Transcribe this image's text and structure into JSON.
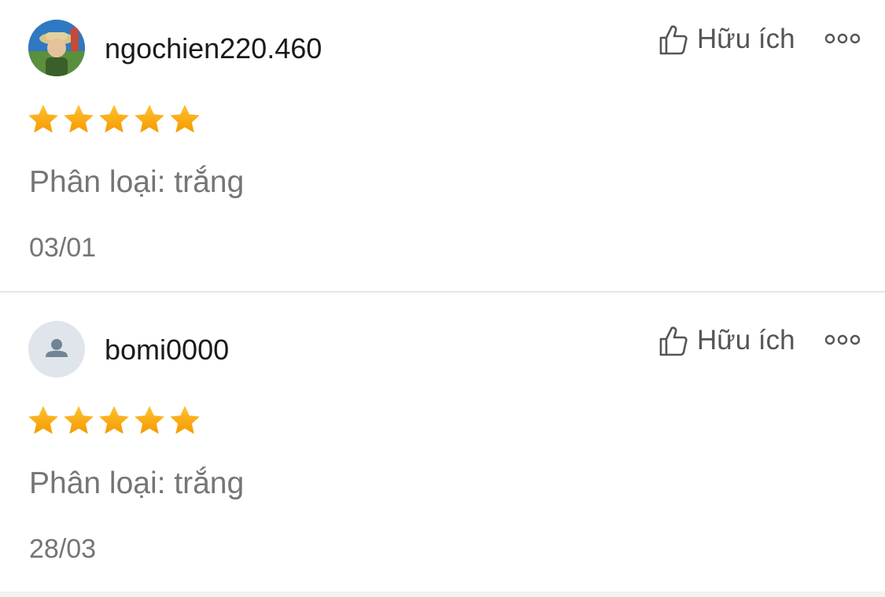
{
  "reviews": [
    {
      "username": "ngochien220.460",
      "avatar": "user-photo",
      "rating": 5,
      "helpful_label": "Hữu ích",
      "variation": "Phân loại: trắng",
      "date": "03/01"
    },
    {
      "username": "bomi0000",
      "avatar": "default-user-icon",
      "rating": 5,
      "helpful_label": "Hữu ích",
      "variation": "Phân loại: trắng",
      "date": "28/03"
    }
  ],
  "icons": {
    "helpful": "thumbs-up-icon",
    "more": "more-options-icon",
    "star": "star-icon"
  },
  "colors": {
    "star": "#f7a400",
    "text_primary": "#1a1a1a",
    "text_secondary": "#757575"
  }
}
